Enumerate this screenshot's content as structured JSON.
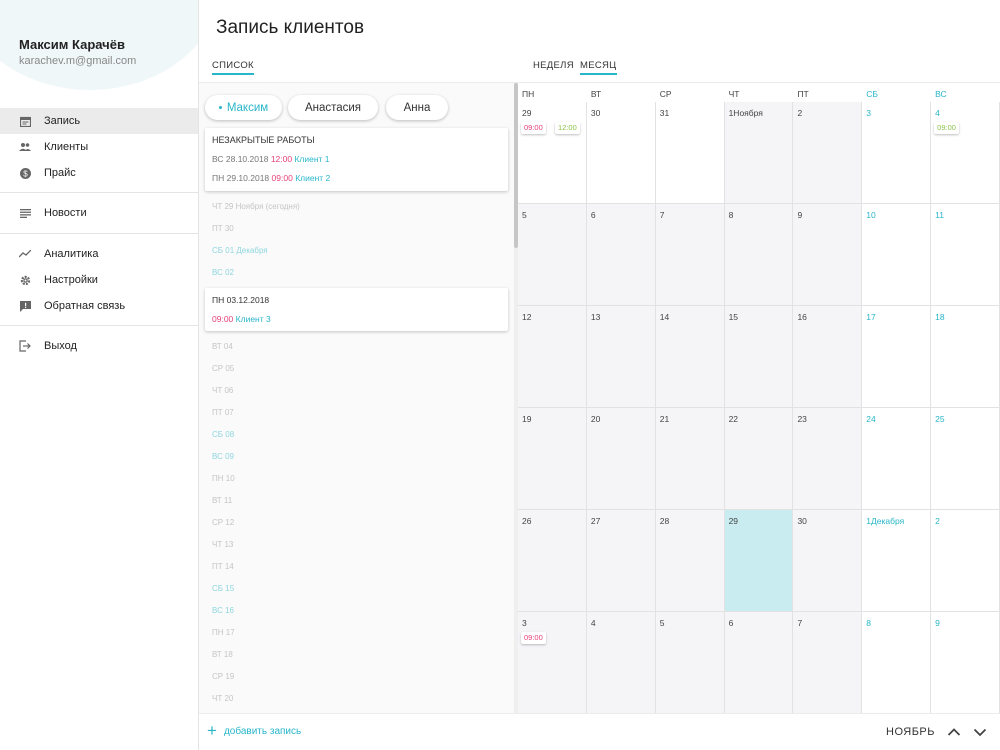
{
  "user": {
    "name": "Максим Карачёв",
    "email": "karachev.m@gmail.com"
  },
  "nav": [
    {
      "label": "Запись",
      "icon": "calendar-icon",
      "active": true
    },
    {
      "label": "Клиенты",
      "icon": "people-icon"
    },
    {
      "label": "Прайс",
      "icon": "dollar-icon"
    },
    {
      "label": "Новости",
      "icon": "list-icon"
    },
    {
      "label": "Аналитика",
      "icon": "chart-icon"
    },
    {
      "label": "Настройки",
      "icon": "gear-icon"
    },
    {
      "label": "Обратная связь",
      "icon": "feedback-icon"
    },
    {
      "label": "Выход",
      "icon": "exit-icon"
    }
  ],
  "page_title": "Запись клиентов",
  "tabs": {
    "list": "СПИСОК",
    "week": "НЕДЕЛЯ",
    "month": "МЕСЯЦ"
  },
  "masters": [
    "Максим",
    "Анастасия",
    "Анна"
  ],
  "unclosed": {
    "title": "НЕЗАКРЫТЫЕ РАБОТЫ",
    "rows": [
      {
        "date": "ВС 28.10.2018",
        "time": "12:00",
        "client": "Клиент 1"
      },
      {
        "date": "ПН 29.10.2018",
        "time": "09:00",
        "client": "Клиент 2"
      }
    ]
  },
  "days_before": [
    {
      "label": "ЧТ 29 Ноября (сегодня)",
      "weekend": false
    },
    {
      "label": "ПТ 30",
      "weekend": false
    },
    {
      "label": "СБ 01 Декабря",
      "weekend": true
    },
    {
      "label": "ВС 02",
      "weekend": true
    }
  ],
  "day_card": {
    "title": "ПН 03.12.2018",
    "time": "09:00",
    "client": "Клиент 3"
  },
  "days_after": [
    {
      "label": "ВТ 04",
      "weekend": false
    },
    {
      "label": "СР 05",
      "weekend": false
    },
    {
      "label": "ЧТ 06",
      "weekend": false
    },
    {
      "label": "ПТ 07",
      "weekend": false
    },
    {
      "label": "СБ 08",
      "weekend": true
    },
    {
      "label": "ВС 09",
      "weekend": true
    },
    {
      "label": "ПН 10",
      "weekend": false
    },
    {
      "label": "ВТ 11",
      "weekend": false
    },
    {
      "label": "СР 12",
      "weekend": false
    },
    {
      "label": "ЧТ 13",
      "weekend": false
    },
    {
      "label": "ПТ 14",
      "weekend": false
    },
    {
      "label": "СБ 15",
      "weekend": true
    },
    {
      "label": "ВС 16",
      "weekend": true
    },
    {
      "label": "ПН 17",
      "weekend": false
    },
    {
      "label": "ВТ 18",
      "weekend": false
    },
    {
      "label": "СР 19",
      "weekend": false
    },
    {
      "label": "ЧТ 20",
      "weekend": false
    }
  ],
  "weekdays": [
    "ПН",
    "ВТ",
    "СР",
    "ЧТ",
    "ПТ",
    "СБ",
    "ВС"
  ],
  "calendar": [
    [
      {
        "d": "29",
        "badges": [
          {
            "t": "09:00",
            "c": "pink"
          },
          {
            "t": "12:00",
            "c": "green"
          }
        ]
      },
      {
        "d": "30"
      },
      {
        "d": "31"
      },
      {
        "d": "1Ноября"
      },
      {
        "d": "2"
      },
      {
        "d": "3"
      },
      {
        "d": "4",
        "badges": [
          {
            "t": "09:00",
            "c": "green"
          }
        ]
      }
    ],
    [
      {
        "d": "5"
      },
      {
        "d": "6"
      },
      {
        "d": "7"
      },
      {
        "d": "8"
      },
      {
        "d": "9"
      },
      {
        "d": "10"
      },
      {
        "d": "11"
      }
    ],
    [
      {
        "d": "12"
      },
      {
        "d": "13"
      },
      {
        "d": "14"
      },
      {
        "d": "15"
      },
      {
        "d": "16"
      },
      {
        "d": "17"
      },
      {
        "d": "18"
      }
    ],
    [
      {
        "d": "19"
      },
      {
        "d": "20"
      },
      {
        "d": "21"
      },
      {
        "d": "22"
      },
      {
        "d": "23"
      },
      {
        "d": "24"
      },
      {
        "d": "25"
      }
    ],
    [
      {
        "d": "26"
      },
      {
        "d": "27"
      },
      {
        "d": "28"
      },
      {
        "d": "29",
        "today": true
      },
      {
        "d": "30"
      },
      {
        "d": "1Декабря"
      },
      {
        "d": "2"
      }
    ],
    [
      {
        "d": "3",
        "badges": [
          {
            "t": "09:00",
            "c": "pink"
          }
        ]
      },
      {
        "d": "4"
      },
      {
        "d": "5"
      },
      {
        "d": "6"
      },
      {
        "d": "7"
      },
      {
        "d": "8"
      },
      {
        "d": "9"
      }
    ]
  ],
  "footer": {
    "add_label": "добавить запись",
    "month": "НОЯБРЬ"
  },
  "colors": {
    "accent": "#29b6c9",
    "pink": "#e63f7a",
    "green": "#8bc34a",
    "today": "#c8ecef"
  }
}
